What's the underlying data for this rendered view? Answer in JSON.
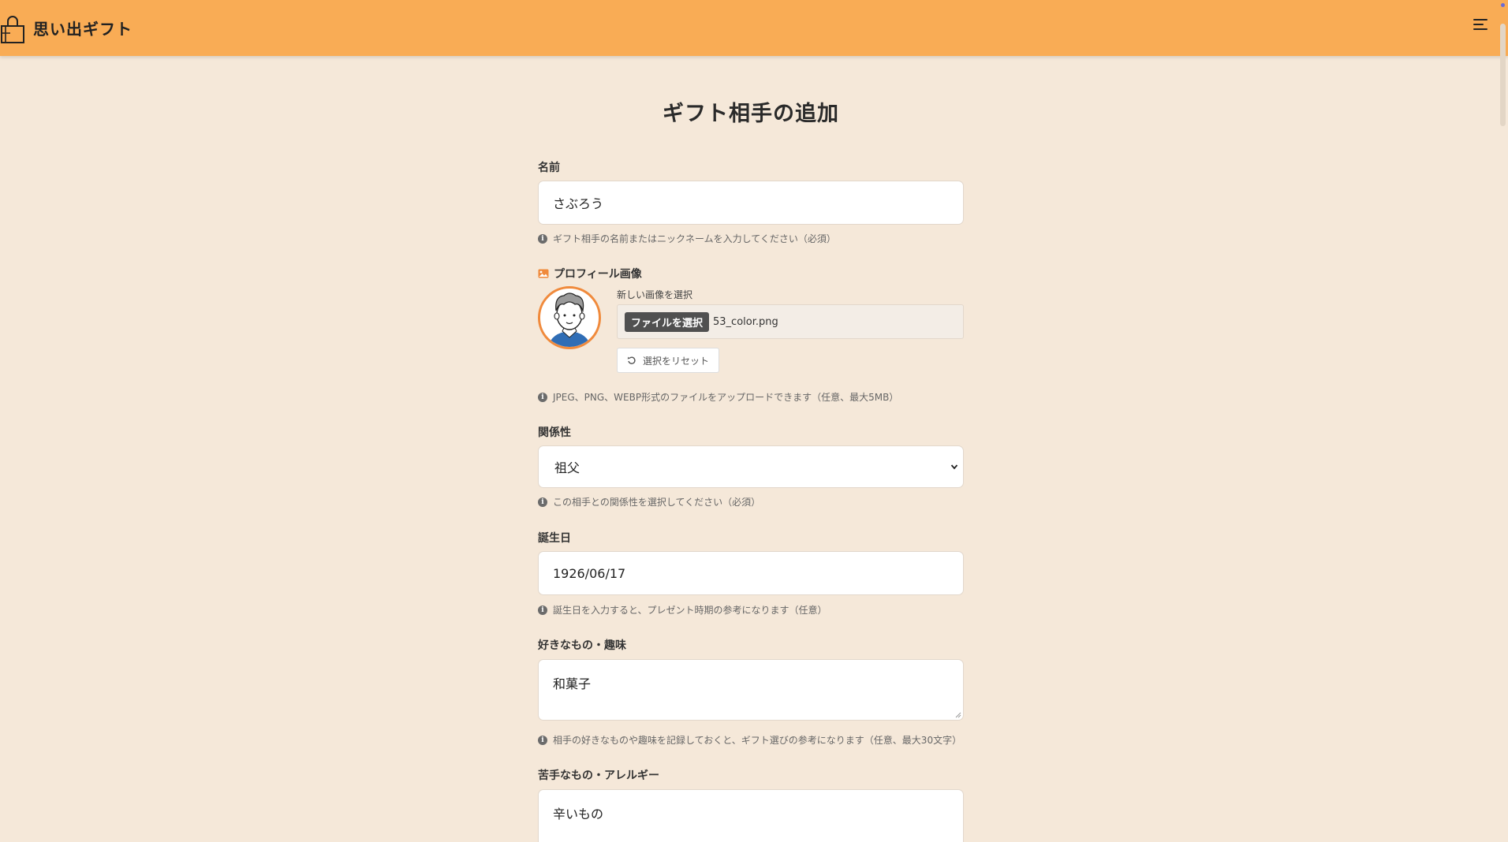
{
  "app": {
    "name": "思い出ギフト"
  },
  "page": {
    "title": "ギフト相手の追加"
  },
  "form": {
    "name": {
      "label": "名前",
      "value": "さぶろう",
      "help": "ギフト相手の名前またはニックネームを入力してください（必須）"
    },
    "profile_image": {
      "label": "プロフィール画像",
      "new_image_label": "新しい画像を選択",
      "file_button": "ファイルを選択",
      "file_name": "53_color.png",
      "reset_button": "選択をリセット",
      "help": "JPEG、PNG、WEBP形式のファイルをアップロードできます（任意、最大5MB）"
    },
    "relationship": {
      "label": "関係性",
      "selected": "祖父",
      "help": "この相手との関係性を選択してください（必須）"
    },
    "birthday": {
      "label": "誕生日",
      "value": "1926/06/17",
      "help": "誕生日を入力すると、プレゼント時期の参考になります（任意）"
    },
    "likes": {
      "label": "好きなもの・趣味",
      "value": "和菓子",
      "help": "相手の好きなものや趣味を記録しておくと、ギフト選びの参考になります（任意、最大30文字）"
    },
    "dislikes": {
      "label": "苦手なもの・アレルギー",
      "value": "辛いもの"
    }
  },
  "colors": {
    "header_bg": "#f9ac55",
    "page_bg": "#f5e8d9",
    "accent": "#f08a3c"
  },
  "icons": [
    "gift-bag-icon",
    "menu-icon",
    "image-icon",
    "info-icon",
    "reset-icon",
    "chevron-down-icon"
  ]
}
